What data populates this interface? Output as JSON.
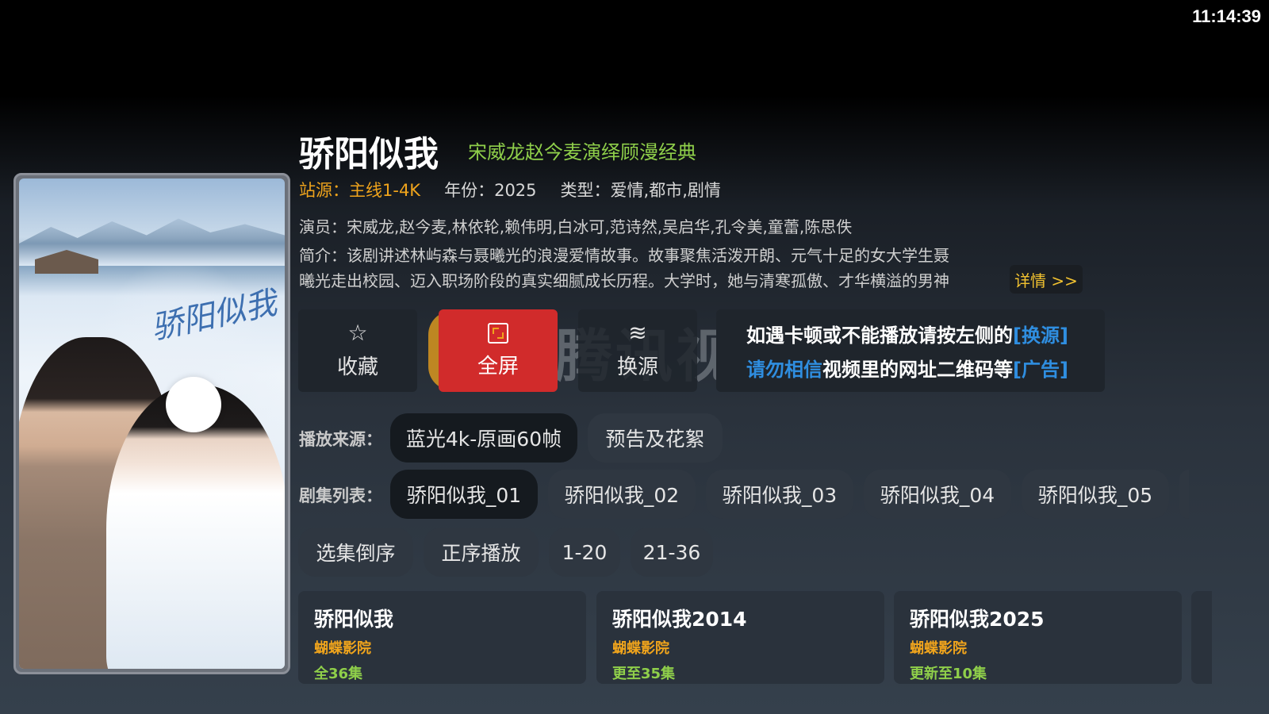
{
  "status_bar": {
    "time": "11:14:39"
  },
  "poster": {
    "calligraphy": "骄阳似我"
  },
  "header": {
    "title": "骄阳似我",
    "subtitle": "宋威龙赵今麦演绎顾漫经典"
  },
  "meta": {
    "source": "站源：主线1-4K",
    "year": "年份：2025",
    "genre": "类型：爱情,都市,剧情"
  },
  "cast": "演员：宋威龙,赵今麦,林依轮,赖伟明,白冰可,范诗然,吴启华,孔令美,童蕾,陈思佚",
  "intro": {
    "line1": "简介：该剧讲述林屿森与聂曦光的浪漫爱情故事。故事聚焦活泼开朗、元气十足的女大学生聂",
    "line2": "曦光走出校园、迈入职场阶段的真实细腻成长历程。大学时，她与清寒孤傲、才华横溢的男神"
  },
  "more_label": "详情 >>",
  "actions": {
    "favorite": {
      "label": "收藏",
      "icon": "star-icon"
    },
    "fullscreen": {
      "label": "全屏",
      "icon": "fullscreen-icon"
    },
    "switch_source": {
      "label": "换源",
      "icon": "layers-icon"
    }
  },
  "watermark": {
    "text": "腾讯视频"
  },
  "notice": {
    "line1_text": "如遇卡顿或不能播放请按左侧的",
    "line1_link": "[换源]",
    "line2_prefix": "请勿相信",
    "line2_text": "视频里的网址二维码等",
    "line2_link": "[广告]"
  },
  "play_source": {
    "label": "播放来源：",
    "options": [
      "蓝光4k-原画60帧",
      "预告及花絮"
    ]
  },
  "episodes": {
    "label": "剧集列表：",
    "items": [
      "骄阳似我_01",
      "骄阳似我_02",
      "骄阳似我_03",
      "骄阳似我_04",
      "骄阳似我_05"
    ]
  },
  "controls": [
    "选集倒序",
    "正序播放",
    "1-20",
    "21-36"
  ],
  "related": [
    {
      "title": "骄阳似我",
      "source": "蝴蝶影院",
      "count": "全36集"
    },
    {
      "title": "骄阳似我2014",
      "source": "蝴蝶影院",
      "count": "更至35集"
    },
    {
      "title": "骄阳似我2025",
      "source": "蝴蝶影院",
      "count": "更新至10集"
    }
  ],
  "colors": {
    "accent_orange": "#f0a41c",
    "accent_green": "#8fcf4a",
    "active_red": "#d12b2b",
    "link_blue": "#2f8ee0"
  }
}
